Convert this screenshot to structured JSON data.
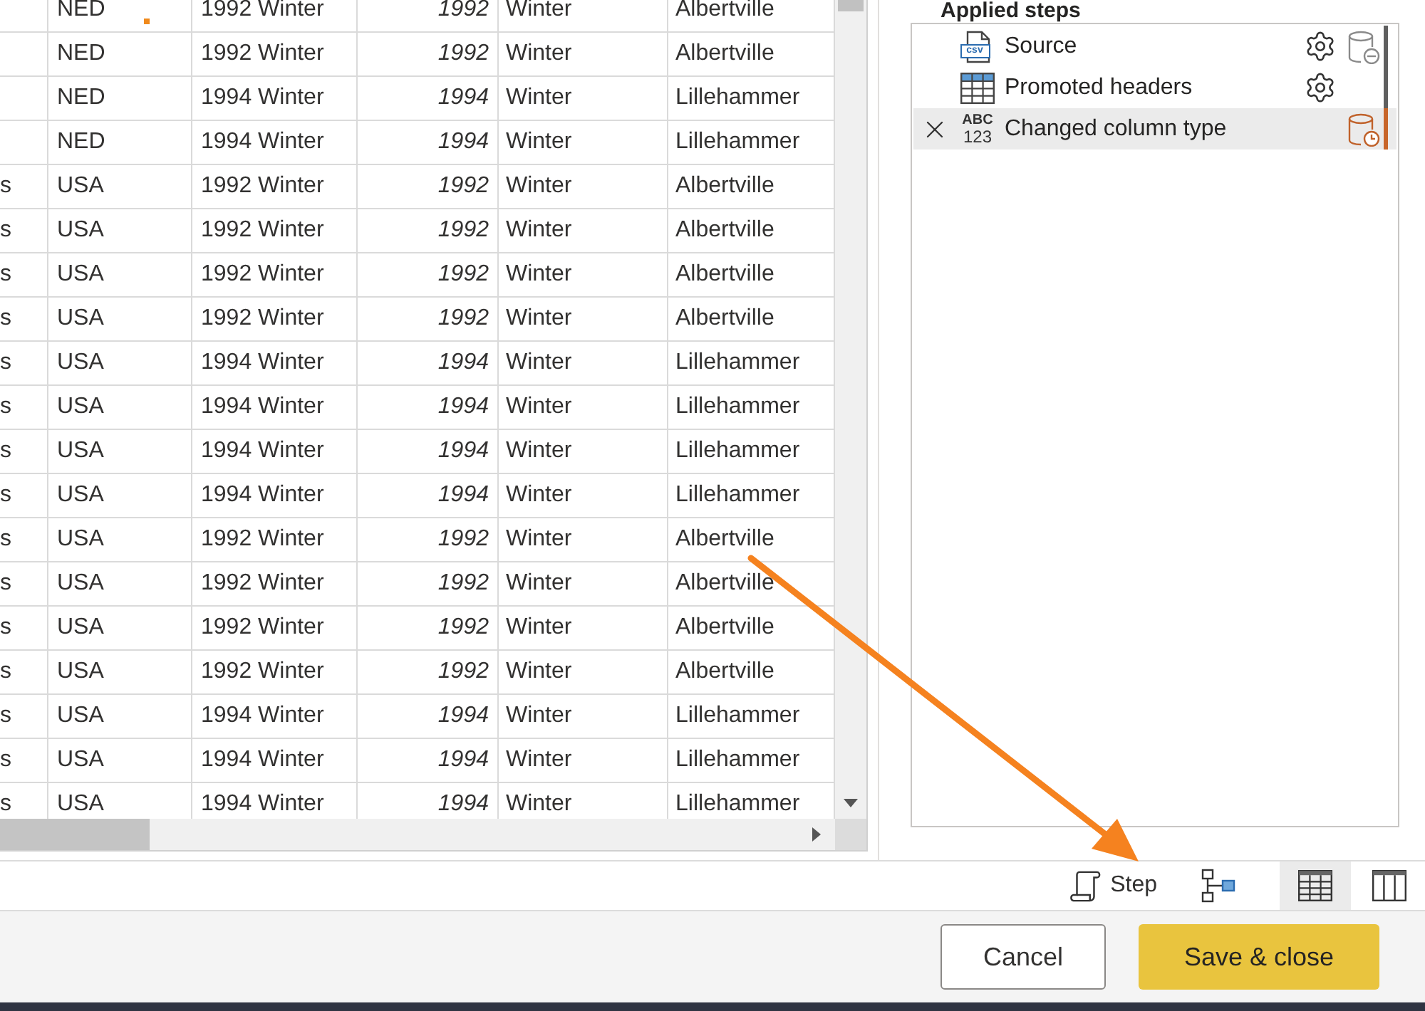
{
  "table": {
    "rows": [
      {
        "column_2": "NED",
        "column_3": "1992 Winter",
        "column_4": "1992",
        "column_5": "Winter",
        "column_6": "Albertville"
      },
      {
        "column_2": "NED",
        "column_3": "1992 Winter",
        "column_4": "1992",
        "column_5": "Winter",
        "column_6": "Albertville"
      },
      {
        "column_2": "NED",
        "column_3": "1994 Winter",
        "column_4": "1994",
        "column_5": "Winter",
        "column_6": "Lillehammer"
      },
      {
        "column_2": "NED",
        "column_3": "1994 Winter",
        "column_4": "1994",
        "column_5": "Winter",
        "column_6": "Lillehammer"
      },
      {
        "column_1": "s",
        "column_2": "USA",
        "column_3": "1992 Winter",
        "column_4": "1992",
        "column_5": "Winter",
        "column_6": "Albertville"
      },
      {
        "column_1": "s",
        "column_2": "USA",
        "column_3": "1992 Winter",
        "column_4": "1992",
        "column_5": "Winter",
        "column_6": "Albertville"
      },
      {
        "column_1": "s",
        "column_2": "USA",
        "column_3": "1992 Winter",
        "column_4": "1992",
        "column_5": "Winter",
        "column_6": "Albertville"
      },
      {
        "column_1": "s",
        "column_2": "USA",
        "column_3": "1992 Winter",
        "column_4": "1992",
        "column_5": "Winter",
        "column_6": "Albertville"
      },
      {
        "column_1": "s",
        "column_2": "USA",
        "column_3": "1994 Winter",
        "column_4": "1994",
        "column_5": "Winter",
        "column_6": "Lillehammer"
      },
      {
        "column_1": "s",
        "column_2": "USA",
        "column_3": "1994 Winter",
        "column_4": "1994",
        "column_5": "Winter",
        "column_6": "Lillehammer"
      },
      {
        "column_1": "s",
        "column_2": "USA",
        "column_3": "1994 Winter",
        "column_4": "1994",
        "column_5": "Winter",
        "column_6": "Lillehammer"
      },
      {
        "column_1": "s",
        "column_2": "USA",
        "column_3": "1994 Winter",
        "column_4": "1994",
        "column_5": "Winter",
        "column_6": "Lillehammer"
      },
      {
        "column_1": "s",
        "column_2": "USA",
        "column_3": "1992 Winter",
        "column_4": "1992",
        "column_5": "Winter",
        "column_6": "Albertville"
      },
      {
        "column_1": "s",
        "column_2": "USA",
        "column_3": "1992 Winter",
        "column_4": "1992",
        "column_5": "Winter",
        "column_6": "Albertville"
      },
      {
        "column_1": "s",
        "column_2": "USA",
        "column_3": "1992 Winter",
        "column_4": "1992",
        "column_5": "Winter",
        "column_6": "Albertville"
      },
      {
        "column_1": "s",
        "column_2": "USA",
        "column_3": "1992 Winter",
        "column_4": "1992",
        "column_5": "Winter",
        "column_6": "Albertville"
      },
      {
        "column_1": "s",
        "column_2": "USA",
        "column_3": "1994 Winter",
        "column_4": "1994",
        "column_5": "Winter",
        "column_6": "Lillehammer"
      },
      {
        "column_1": "s",
        "column_2": "USA",
        "column_3": "1994 Winter",
        "column_4": "1994",
        "column_5": "Winter",
        "column_6": "Lillehammer"
      },
      {
        "column_1": "s",
        "column_2": "USA",
        "column_3": "1994 Winter",
        "column_4": "1994",
        "column_5": "Winter",
        "column_6": "Lillehammer"
      }
    ]
  },
  "applied_steps": {
    "title": "Applied steps",
    "steps": [
      {
        "name": "Source",
        "kind": "csv",
        "icon_text": [
          "csv"
        ],
        "selected": false,
        "settings": true,
        "status_icon": {
          "kind": "minus"
        },
        "color": "#5f5f5f"
      },
      {
        "name": "Promoted headers",
        "kind": "table",
        "selected": false,
        "settings": true,
        "color": "#5f5f5f"
      },
      {
        "name": "Changed column type",
        "kind": "type",
        "icon_text": [
          "ABC",
          "123"
        ],
        "selected": true,
        "settings": false,
        "status_icon": {
          "kind": "clock"
        },
        "color": "#c8662a"
      }
    ]
  },
  "view_toolbar": {
    "items": [
      {
        "kind": "step",
        "label": "Step",
        "selected": false
      },
      {
        "kind": "diagram",
        "selected": false
      },
      {
        "kind": "table",
        "selected": true
      },
      {
        "kind": "schema",
        "selected": false
      }
    ]
  },
  "footer": {
    "buttons": [
      {
        "kind": "secondary",
        "label": "Cancel"
      },
      {
        "kind": "primary",
        "label": "Save & close"
      }
    ]
  }
}
